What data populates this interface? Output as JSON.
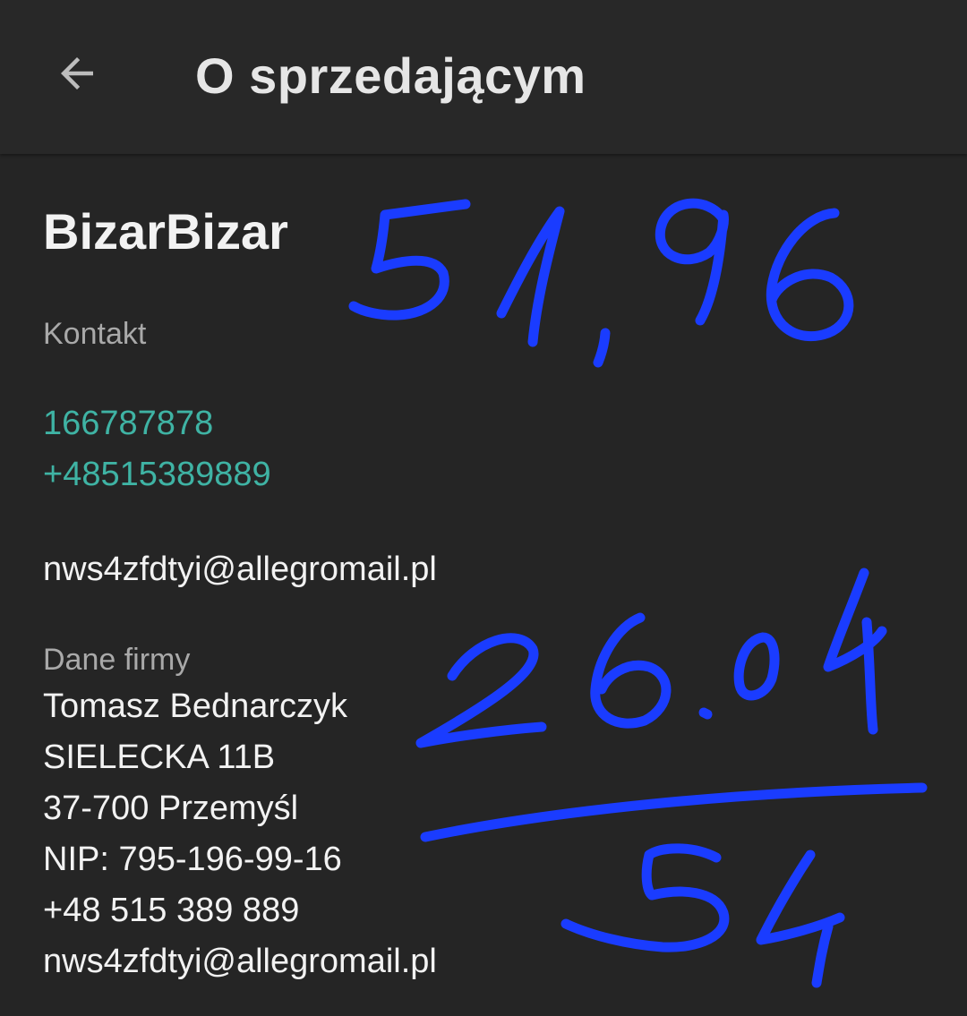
{
  "header": {
    "title": "O sprzedającym",
    "back_icon": "arrow-left-icon"
  },
  "seller": {
    "name": "BizarBizar"
  },
  "contact": {
    "label": "Kontakt",
    "phones": [
      "166787878",
      "+48515389889"
    ],
    "email": "nws4zfdtyi@allegromail.pl"
  },
  "company": {
    "label": "Dane firmy",
    "lines": [
      "Tomasz Bednarczyk",
      "SIELECKA 11B",
      "37-700 Przemyśl",
      "NIP: 795-196-99-16",
      "+48 515 389 889",
      "nws4zfdtyi@allegromail.pl"
    ]
  },
  "handwriting": {
    "top_number": "51,96",
    "middle_number": "26.04",
    "result_number": "54",
    "ink_color": "#1a3cff"
  },
  "colors": {
    "background": "#252525",
    "link": "#3fb3a4",
    "label": "#a9a9a9"
  }
}
